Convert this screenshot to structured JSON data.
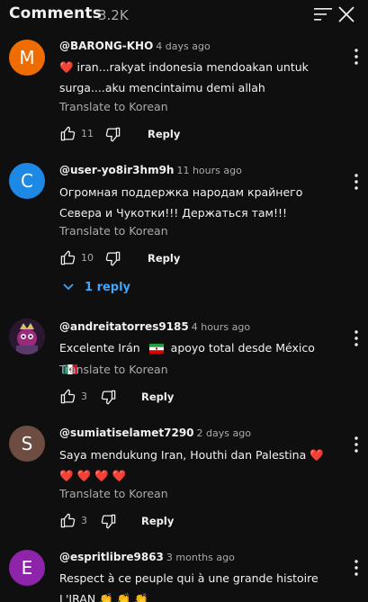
{
  "header": {
    "title": "Comments",
    "count": "3.2K"
  },
  "comments": [
    {
      "avatar_letter": "M",
      "avatar_color": "#ef6c00",
      "author": "@BARONG-KHO",
      "time": "4 days ago",
      "text_lines": [
        "❤️ iran...rakyat indonesia mendoakan untuk",
        "surga....aku mencintaimu demi allah"
      ],
      "translate": "Translate to Korean",
      "likes": "11",
      "reply": "Reply"
    },
    {
      "avatar_letter": "C",
      "avatar_color": "#1e88e5",
      "author": "@user-yo8ir3hm9h",
      "time": "11 hours ago",
      "text_lines": [
        "Огромная поддержка народам крайнего",
        "Севера и Чукотки!!! Держаться там!!!"
      ],
      "translate": "Translate to Korean",
      "likes": "10",
      "reply": "Reply",
      "replies_link": "1 reply"
    },
    {
      "avatar_letter": "",
      "avatar_color": "#3b1f3a",
      "author": "@andreitatorres9185",
      "time": "4 hours ago",
      "text_lines": [
        "Excelente Irán",
        "apoyo total desde México"
      ],
      "translate": "Translate to Korean",
      "likes": "3",
      "reply": "Reply"
    },
    {
      "avatar_letter": "S",
      "avatar_color": "#6d4c41",
      "author": "@sumiatiselamet7290",
      "time": "2 days ago",
      "text_lines": [
        "Saya mendukung Iran, Houthi dan Palestina ❤️",
        "❤️ ❤️ ❤️ ❤️"
      ],
      "translate": "Translate to Korean",
      "likes": "3",
      "reply": "Reply"
    },
    {
      "avatar_letter": "E",
      "avatar_color": "#8e24aa",
      "author": "@espritlibre9863",
      "time": "3 months ago",
      "text_lines": [
        "Respect à ce peuple qui à une grande histoire",
        "L'IRAN 👏 👏 👏"
      ]
    }
  ]
}
